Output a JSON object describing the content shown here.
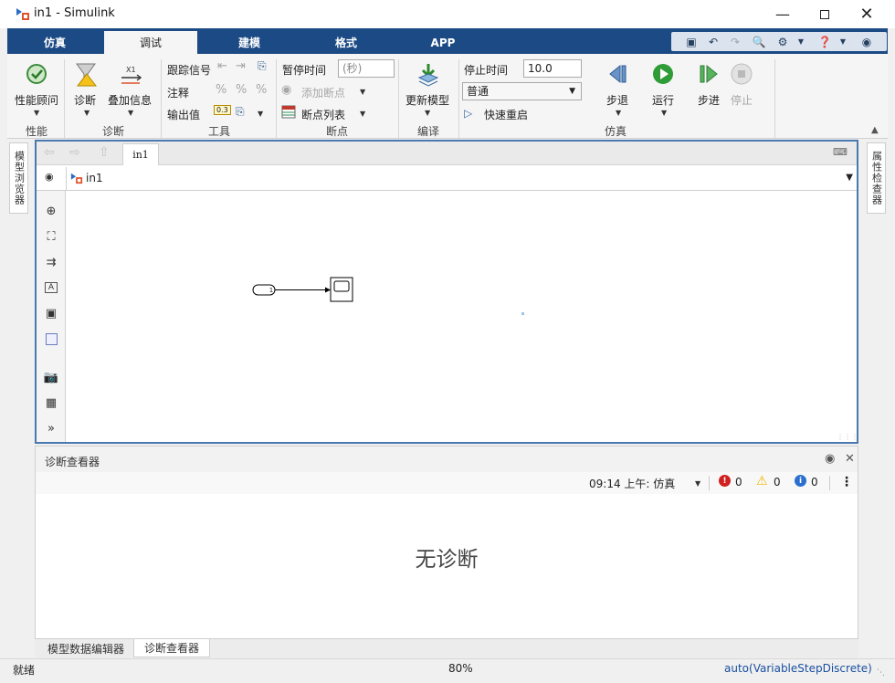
{
  "window": {
    "title": "in1 - Simulink"
  },
  "tabs": [
    {
      "label": "仿真"
    },
    {
      "label": "调试"
    },
    {
      "label": "建模"
    },
    {
      "label": "格式"
    },
    {
      "label": "APP"
    }
  ],
  "ribbon": {
    "perf": {
      "btn": "性能顾问",
      "group": "性能"
    },
    "diagnose": {
      "btn_diag": "诊断",
      "btn_overlay": "叠加信息",
      "group": "诊断"
    },
    "tools": {
      "trace_signal": "跟踪信号",
      "annotate": "注释",
      "output_value": "输出值",
      "value_badge": "0.3",
      "group": "工具"
    },
    "breakpoints": {
      "pause_time": "暂停时间",
      "pause_placeholder": "(秒)",
      "add_bp": "添加断点",
      "bp_list": "断点列表",
      "group": "断点"
    },
    "compile": {
      "update": "更新模型",
      "group": "编译"
    },
    "simulate": {
      "stop_time_label": "停止时间",
      "stop_time_value": "10.0",
      "mode": "普通",
      "fast_restart": "快速重启",
      "step_back": "步退",
      "run": "运行",
      "step_forward": "步进",
      "stop": "停止",
      "group": "仿真"
    }
  },
  "left_panel": {
    "label": "模型浏览器"
  },
  "right_panel": {
    "label": "属性检查器"
  },
  "canvas": {
    "tab": "in1",
    "breadcrumb": "in1",
    "inport_number": "1"
  },
  "diagnostics": {
    "title": "诊断查看器",
    "timestamp": "09:14 上午: 仿真",
    "errors": "0",
    "warnings": "0",
    "infos": "0",
    "empty_message": "无诊断"
  },
  "bottom_tabs": [
    {
      "label": "模型数据编辑器"
    },
    {
      "label": "诊断查看器"
    }
  ],
  "status": {
    "state": "就绪",
    "zoom": "80%",
    "solver": "auto(VariableStepDiscrete)"
  },
  "colors": {
    "tab_bar": "#1b4a84",
    "canvas_border": "#4a79b0",
    "run_green": "#2f9c37",
    "error_red": "#d02020",
    "warning_yellow": "#f2b600",
    "info_blue": "#2a6fd0",
    "solver_link": "#1a4fa0"
  }
}
